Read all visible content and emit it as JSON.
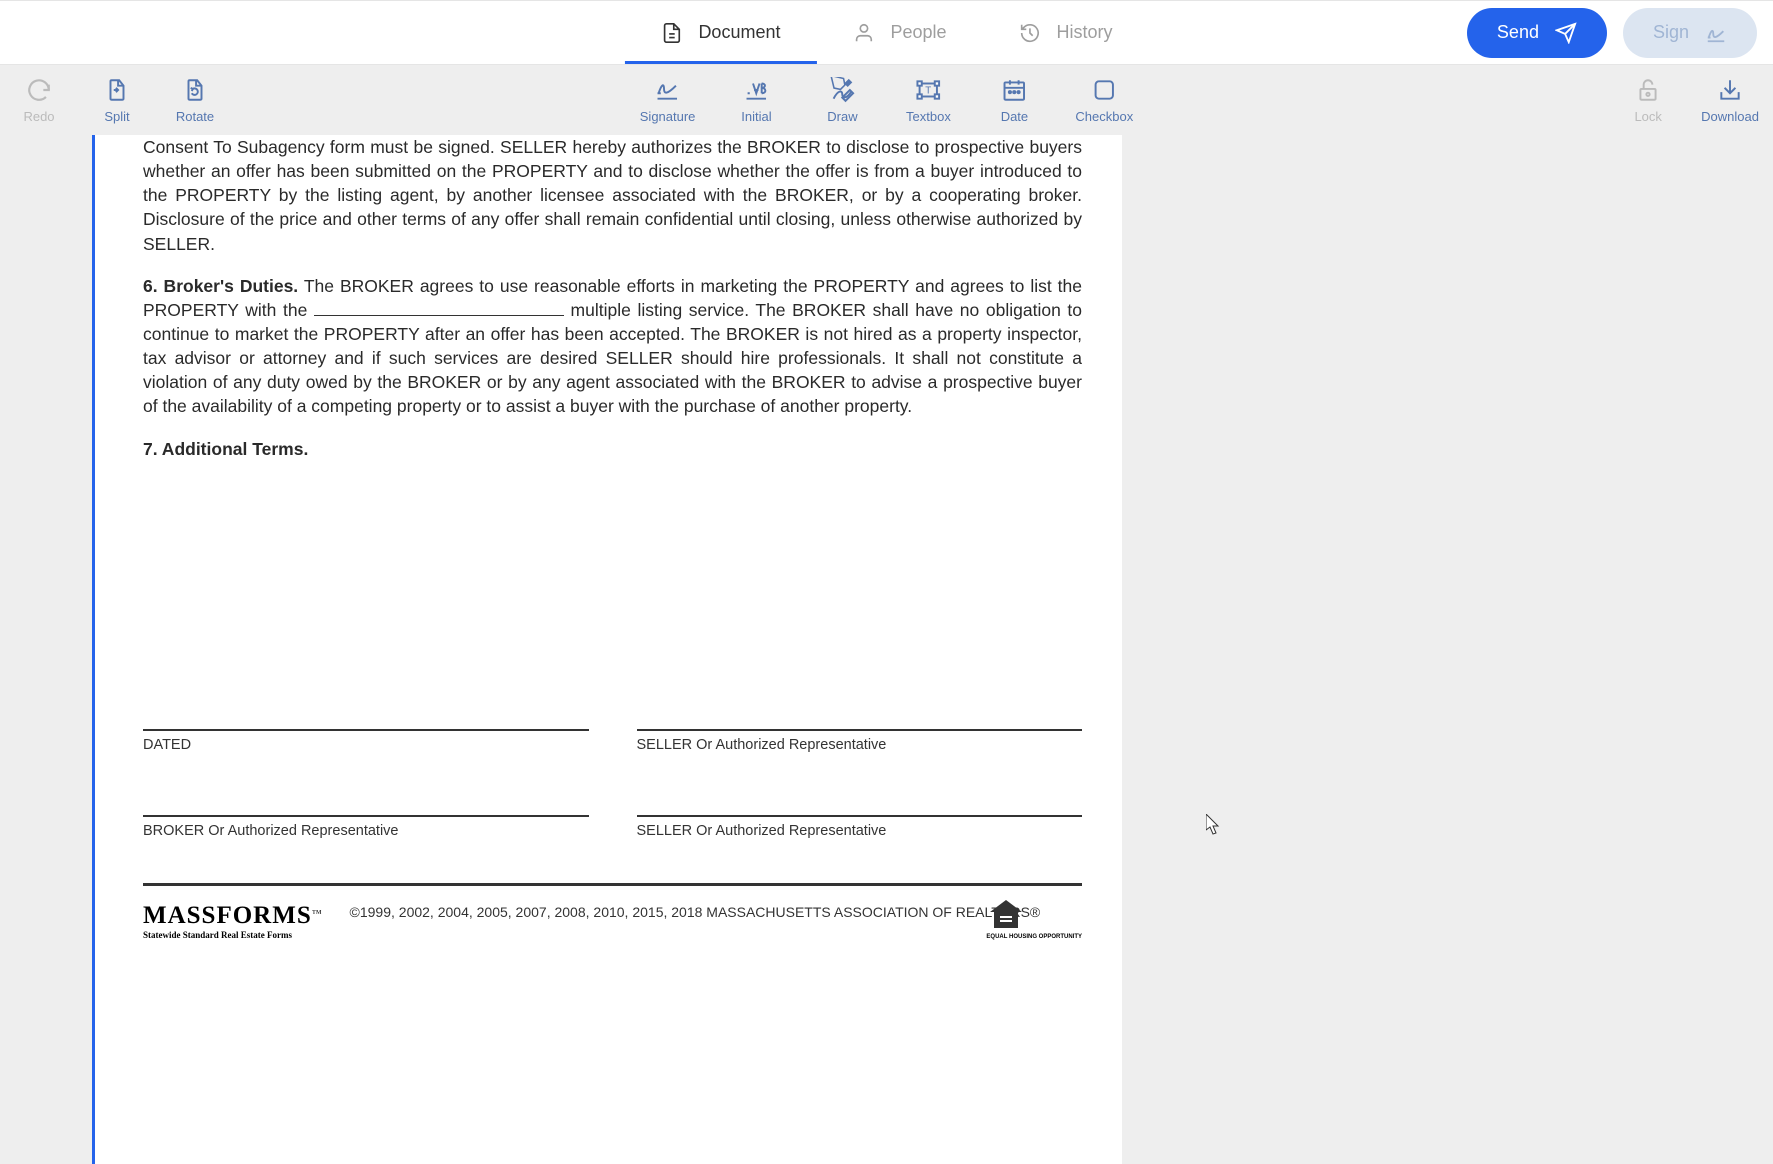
{
  "top_nav": {
    "tabs": [
      {
        "label": "Document",
        "active": true
      },
      {
        "label": "People",
        "active": false
      },
      {
        "label": "History",
        "active": false
      }
    ],
    "send_label": "Send",
    "sign_label": "Sign"
  },
  "toolbar": {
    "left": [
      {
        "label": "Redo",
        "disabled": true
      },
      {
        "label": "Split",
        "disabled": false
      },
      {
        "label": "Rotate",
        "disabled": false
      }
    ],
    "center": [
      {
        "label": "Signature"
      },
      {
        "label": "Initial"
      },
      {
        "label": "Draw"
      },
      {
        "label": "Textbox"
      },
      {
        "label": "Date"
      },
      {
        "label": "Checkbox"
      }
    ],
    "right": [
      {
        "label": "Lock",
        "disabled": true
      },
      {
        "label": "Download",
        "disabled": false
      }
    ]
  },
  "document": {
    "para_subagency_partial": "Consent To Subagency form must be signed. SELLER hereby authorizes the BROKER to disclose to prospective buyers whether an offer has been submitted on the PROPERTY and to disclose whether the offer is from a buyer introduced to the PROPERTY by the listing agent, by another licensee associated with the BROKER, or by a cooperating broker. Disclosure of the price and other terms of any offer shall remain confidential until closing, unless otherwise authorized by SELLER.",
    "section6_title": "6. Broker's Duties.",
    "section6_body_part1": " The BROKER agrees to use reasonable efforts in marketing the PROPERTY and agrees to list the PROPERTY with the ",
    "section6_body_part2": " multiple listing service. The BROKER shall have no obligation to continue to market the PROPERTY after an offer has been accepted. The BROKER is not hired as a property inspector, tax advisor or attorney and if such services are desired SELLER should hire professionals. It shall not constitute a violation of any duty owed by the BROKER or by any agent associated with the BROKER to advise a prospective buyer of the availability of a competing property or to assist a buyer with the purchase of another property.",
    "section7_title": "7.  Additional Terms.",
    "sig_labels": {
      "dated": "DATED",
      "seller1": "SELLER Or Authorized Representative",
      "broker": "BROKER Or Authorized Representative",
      "seller2": "SELLER Or Authorized Representative"
    },
    "footer": {
      "logo_main": "MASSFORMS",
      "logo_tm": "™",
      "logo_sub": "Statewide Standard Real Estate Forms",
      "copyright": "©1999, 2002, 2004, 2005, 2007, 2008, 2010, 2015, 2018 MASSACHUSETTS ASSOCIATION OF REALTORS®",
      "housing_text": "EQUAL HOUSING\nOPPORTUNITY"
    }
  }
}
